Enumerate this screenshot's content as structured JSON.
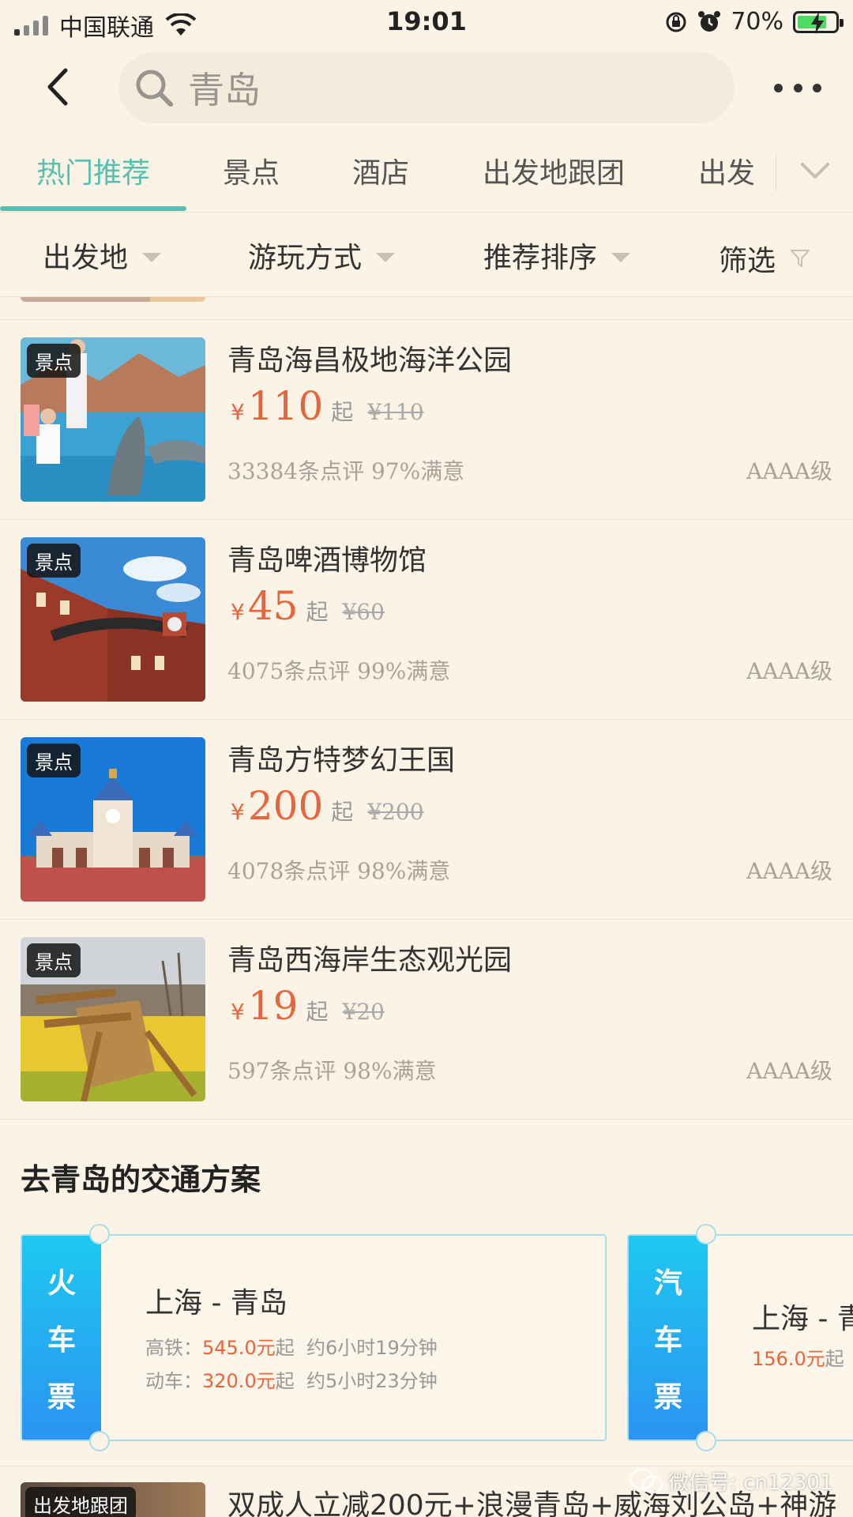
{
  "status_bar": {
    "carrier": "中国联通",
    "time": "19:01",
    "battery": "70%"
  },
  "search": {
    "query": "青岛"
  },
  "tabs": [
    "热门推荐",
    "景点",
    "酒店",
    "出发地跟团",
    "出发"
  ],
  "active_tab": "热门推荐",
  "filters": [
    "出发地",
    "游玩方式",
    "推荐排序",
    "筛选"
  ],
  "items": [
    {
      "tag": "景点",
      "title": "青岛海昌极地海洋公园",
      "currency": "¥",
      "price": "110",
      "qi": "起",
      "original": "¥110",
      "reviews": "33384条点评 97%满意",
      "grade": "AAAA级"
    },
    {
      "tag": "景点",
      "title": "青岛啤酒博物馆",
      "currency": "¥",
      "price": "45",
      "qi": "起",
      "original": "¥60",
      "reviews": "4075条点评 99%满意",
      "grade": "AAAA级"
    },
    {
      "tag": "景点",
      "title": "青岛方特梦幻王国",
      "currency": "¥",
      "price": "200",
      "qi": "起",
      "original": "¥200",
      "reviews": "4078条点评 98%满意",
      "grade": "AAAA级"
    },
    {
      "tag": "景点",
      "title": "青岛西海岸生态观光园",
      "currency": "¥",
      "price": "19",
      "qi": "起",
      "original": "¥20",
      "reviews": "597条点评 98%满意",
      "grade": "AAAA级"
    }
  ],
  "transport": {
    "title": "去青岛的交通方案",
    "cards": [
      {
        "type_chars": [
          "火",
          "车",
          "票"
        ],
        "route": "上海 - 青岛",
        "lines": [
          {
            "label": "高铁：",
            "price": "545.0元",
            "qi": "起",
            "duration": "约6小时19分钟"
          },
          {
            "label": "动车：",
            "price": "320.0元",
            "qi": "起",
            "duration": "约5小时23分钟"
          }
        ]
      },
      {
        "type_chars": [
          "汽",
          "车",
          "票"
        ],
        "route": "上海 - 青",
        "lines": [
          {
            "label": "",
            "price": "156.0元",
            "qi": "起",
            "duration": ""
          }
        ]
      }
    ]
  },
  "bottom_item": {
    "tag": "出发地跟团",
    "title": "双成人立减200元+浪漫青岛+威海刘公岛+神游"
  },
  "watermark": "微信号: cn12301",
  "colors": {
    "background": "#fbf4e6",
    "accent": "#57bfb0",
    "price": "#e8643a",
    "ticket_side": "#1ec8f0"
  }
}
